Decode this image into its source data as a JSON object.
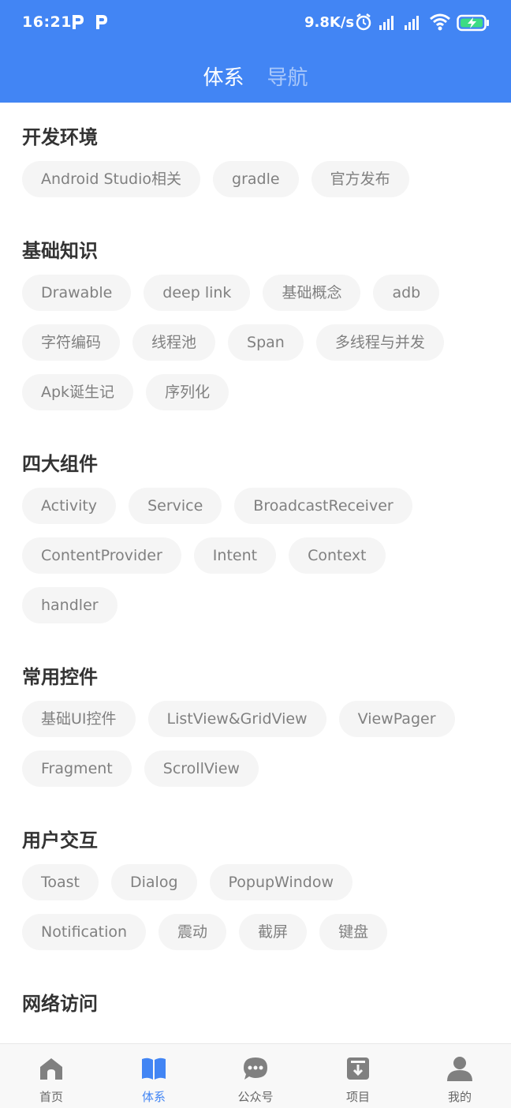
{
  "status_bar": {
    "time": "16:21",
    "speed": "9.8K/s",
    "icons": [
      "p-icon",
      "p-icon",
      "alarm-icon",
      "signal-hd-icon",
      "signal-icon",
      "wifi-icon",
      "battery-charging-icon"
    ]
  },
  "header": {
    "tabs": [
      {
        "label": "体系",
        "active": true
      },
      {
        "label": "导航",
        "active": false
      }
    ],
    "color": "#4285F4"
  },
  "sections": [
    {
      "title": "开发环境",
      "tags": [
        "Android Studio相关",
        "gradle",
        "官方发布"
      ]
    },
    {
      "title": "基础知识",
      "tags": [
        "Drawable",
        "deep link",
        "基础概念",
        "adb",
        "字符编码",
        "线程池",
        "Span",
        "多线程与并发",
        "Apk诞生记",
        "序列化"
      ]
    },
    {
      "title": "四大组件",
      "tags": [
        "Activity",
        "Service",
        "BroadcastReceiver",
        "ContentProvider",
        "Intent",
        "Context",
        "handler"
      ]
    },
    {
      "title": "常用控件",
      "tags": [
        "基础UI控件",
        "ListView&GridView",
        "ViewPager",
        "Fragment",
        "ScrollView"
      ]
    },
    {
      "title": "用户交互",
      "tags": [
        "Toast",
        "Dialog",
        "PopupWindow",
        "Notification",
        "震动",
        "截屏",
        "键盘"
      ]
    },
    {
      "title": "网络访问",
      "tags": []
    }
  ],
  "bottom_nav": [
    {
      "label": "首页",
      "icon": "home-icon",
      "active": false
    },
    {
      "label": "体系",
      "icon": "book-icon",
      "active": true
    },
    {
      "label": "公众号",
      "icon": "chat-icon",
      "active": false
    },
    {
      "label": "项目",
      "icon": "project-box-icon",
      "active": false
    },
    {
      "label": "我的",
      "icon": "user-icon",
      "active": false
    }
  ]
}
